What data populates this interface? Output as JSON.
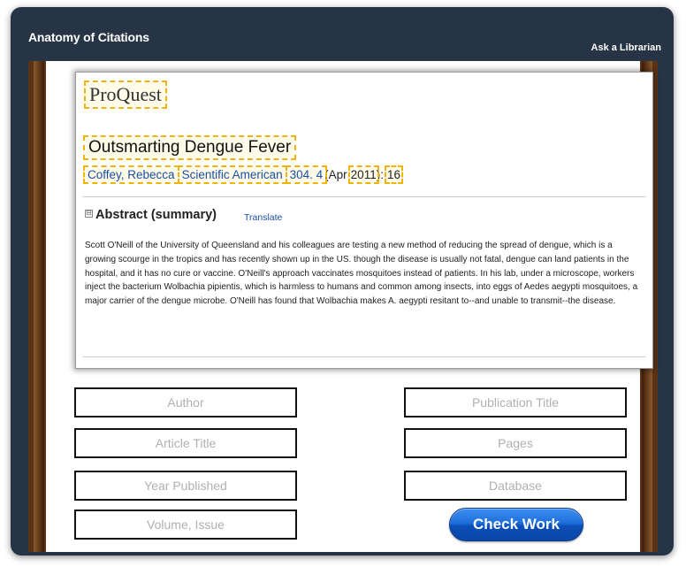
{
  "app": {
    "title": "Anatomy of Citations",
    "ask_link": "Ask a Librarian"
  },
  "record": {
    "logo": "ProQuest",
    "article_title": "Outsmarting Dengue Fever",
    "author": "Coffey, Rebecca",
    "publication": "Scientific American",
    "volume_issue": "304. 4",
    "date_prefix": "(Apr",
    "year": "2011",
    "colon": "):",
    "pages": "16",
    "abstract_heading": "Abstract (summary)",
    "abstract_toggle": "⊟",
    "translate_link": "Translate",
    "abstract_text": "Scott O'Neill of the University of Queensland and his colleagues are testing a new method of reducing the spread of dengue, which is a growing scourge in the tropics and has recently shown up in the US. though the disease is usually not fatal, dengue can land patients in the hospital, and it has no cure or vaccine. O'Neill's approach vaccinates mosquitoes instead of patients. In his lab, under a microscope, workers inject the bacterium Wolbachia pipientis, which is harmless to humans and common among insects, into eggs of Aedes aegypti mosquitoes, a major carrier of the dengue microbe. O'Neill has found that Wolbachia makes A. aegypti resitant to--and unable to transmit--the disease."
  },
  "targets": {
    "author": "Author",
    "publication_title": "Publication Title",
    "article_title": "Article Title",
    "pages": "Pages",
    "year_published": "Year Published",
    "database": "Database",
    "volume_issue": "Volume, Issue"
  },
  "check_button": "Check Work",
  "colors": {
    "header_bg": "#263445",
    "frame_wood": "#5b3417",
    "highlight": "#f2b400",
    "link": "#1a4fa1",
    "button": "#1f6fdb"
  }
}
